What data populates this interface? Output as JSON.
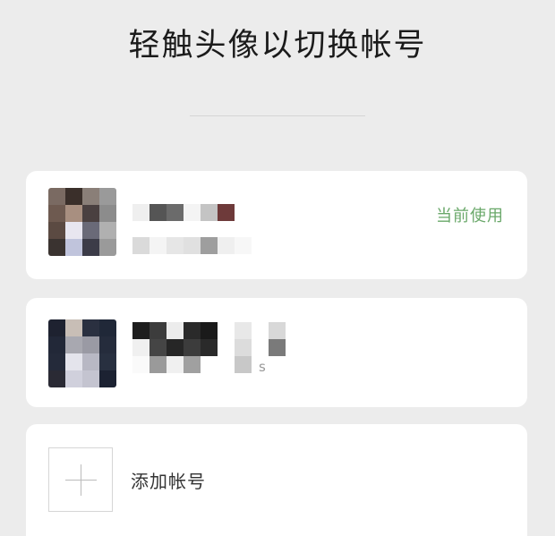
{
  "header": {
    "title": "轻触头像以切换帐号"
  },
  "accounts": [
    {
      "avatar": "avatar-image",
      "status": "当前使用"
    },
    {
      "avatar": "avatar-image",
      "name_fragment": "s"
    }
  ],
  "add_account": {
    "label": "添加帐号",
    "icon": "plus-icon"
  },
  "colors": {
    "background": "#ececec",
    "card": "#ffffff",
    "accent_green": "#6aa86a"
  }
}
